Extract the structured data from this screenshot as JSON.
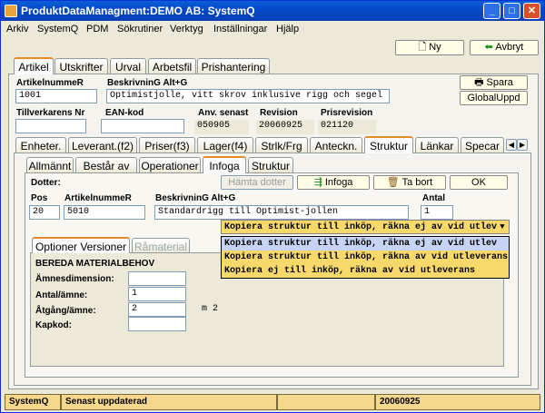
{
  "window": {
    "title": "ProduktDataManagment:DEMO AB: SystemQ",
    "min": "_",
    "max": "□",
    "close": "✕"
  },
  "menu": [
    "Arkiv",
    "SystemQ",
    "PDM",
    "Sökrutiner",
    "Verktyg",
    "Inställningar",
    "Hjälp"
  ],
  "toolbar": {
    "new_label": "Ny",
    "cancel_label": "Avbryt"
  },
  "main_tabs": [
    "Artikel",
    "Utskrifter",
    "Urval",
    "Arbetsfil",
    "Prishantering"
  ],
  "article": {
    "nr_label": "ArtikelnummeR",
    "nr_value": "1001",
    "desc_label": "BeskrivninG Alt+G",
    "desc_value": "Optimistjolle, vitt skrov inklusive rigg och segel",
    "mfr_label": "Tillverkarens Nr",
    "mfr_value": "",
    "ean_label": "EAN-kod",
    "ean_value": "",
    "last_used_label": "Anv. senast",
    "last_used_value": "050905",
    "rev_label": "Revision",
    "rev_value": "20060925",
    "price_rev_label": "Prisrevision",
    "price_rev_value": "021120"
  },
  "side_buttons": {
    "save": "Spara",
    "global": "GlobalUppd"
  },
  "sub_tabs": [
    "Enheter.",
    "Leverant.(f2)",
    "Priser(f3)",
    "Lager(f4)",
    "Strlk/Frg",
    "Anteckn.",
    "Struktur",
    "Länkar",
    "Specar"
  ],
  "struct_tabs": [
    "Allmännt",
    "Består av",
    "Operationer",
    "Infoga",
    "Struktur"
  ],
  "infoga": {
    "dotter_label": "Dotter:",
    "fetch_btn": "Hämta dotter",
    "insert_btn": "Infoga",
    "delete_btn": "Ta bort",
    "ok_btn": "OK",
    "pos_label": "Pos",
    "pos_value": "20",
    "nr_label": "ArtikelnummeR",
    "nr_value": "5010",
    "desc_label": "BeskrivninG Alt+G",
    "desc_value": "Standardrigg till Optimist-jollen",
    "qty_label": "Antal",
    "qty_value": "1",
    "combo_value": "Kopiera struktur till inköp, räkna ej av vid utlev",
    "options": [
      "Kopiera struktur till inköp, räkna ej av vid utlev",
      "Kopiera struktur till inköp, räkna av vid utleverans",
      "Kopiera ej till inköp, räkna av vid utleverans"
    ]
  },
  "opt_tabs": [
    "Optioner Versioner",
    "Råmaterial"
  ],
  "material": {
    "heading": "BEREDA MATERIALBEHOV",
    "dim_label": "Ämnesdimension:",
    "dim_value": "",
    "qty_label": "Antal/ämne:",
    "qty_value": "1",
    "use_label": "Åtgång/ämne:",
    "use_value": "2",
    "use_unit": "m 2",
    "cap_label": "Kapkod:",
    "cap_value": ""
  },
  "status": {
    "app": "SystemQ",
    "updated_label": "Senast uppdaterad",
    "date": "20060925"
  }
}
